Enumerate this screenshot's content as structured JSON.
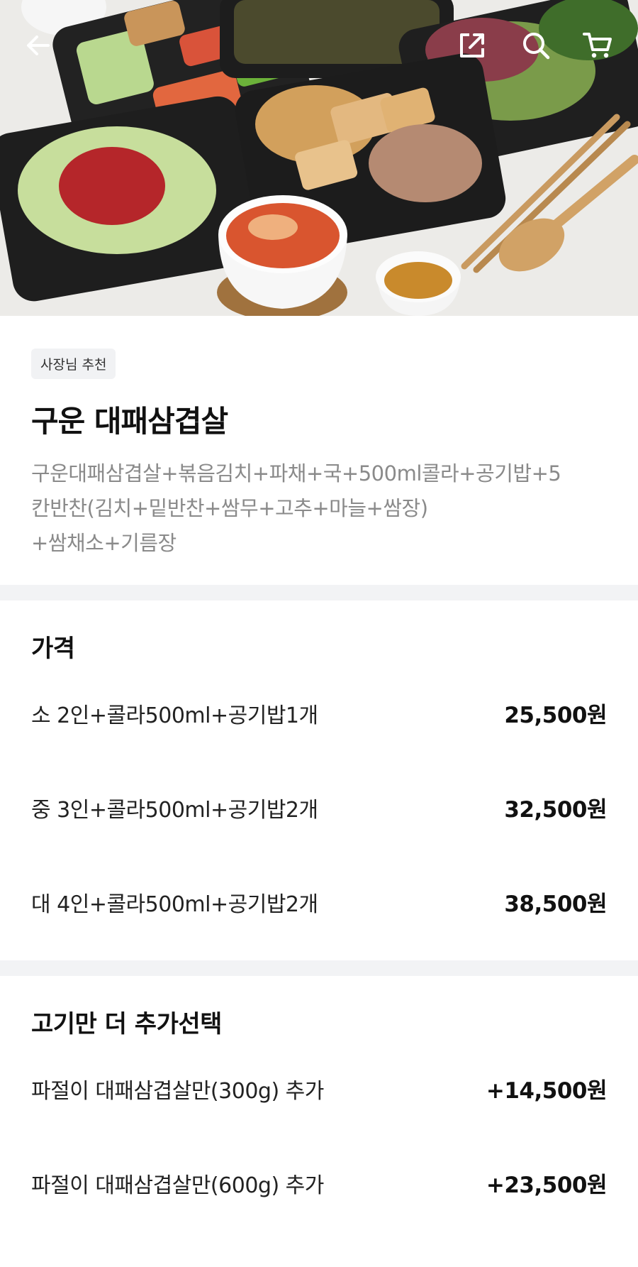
{
  "header": {
    "back_icon": "arrow-left-icon",
    "share_icon": "share-icon",
    "search_icon": "search-icon",
    "cart_icon": "cart-icon"
  },
  "product": {
    "badge": "사장님 추천",
    "title": "구운 대패삼겹살",
    "description_lines": [
      "구운대패삼겹살+볶음김치+파채+국+500ml콜라+공기밥+5",
      "칸반찬(김치+밑반찬+쌈무+고추+마늘+쌈장)",
      "+쌈채소+기름장"
    ]
  },
  "price_section": {
    "title": "가격",
    "options": [
      {
        "label": "소 2인+콜라500ml+공기밥1개",
        "price": "25,500원"
      },
      {
        "label": "중 3인+콜라500ml+공기밥2개",
        "price": "32,500원"
      },
      {
        "label": "대 4인+콜라500ml+공기밥2개",
        "price": "38,500원"
      }
    ]
  },
  "addon_section": {
    "title": "고기만 더 추가선택",
    "options": [
      {
        "label": "파절이 대패삼겹살만(300g) 추가",
        "price": "+14,500원"
      },
      {
        "label": "파절이 대패삼겹살만(600g) 추가",
        "price": "+23,500원"
      }
    ]
  },
  "colors": {
    "divider": "#f2f3f5",
    "muted_text": "#8a8a8a",
    "badge_bg": "#f1f2f4"
  }
}
